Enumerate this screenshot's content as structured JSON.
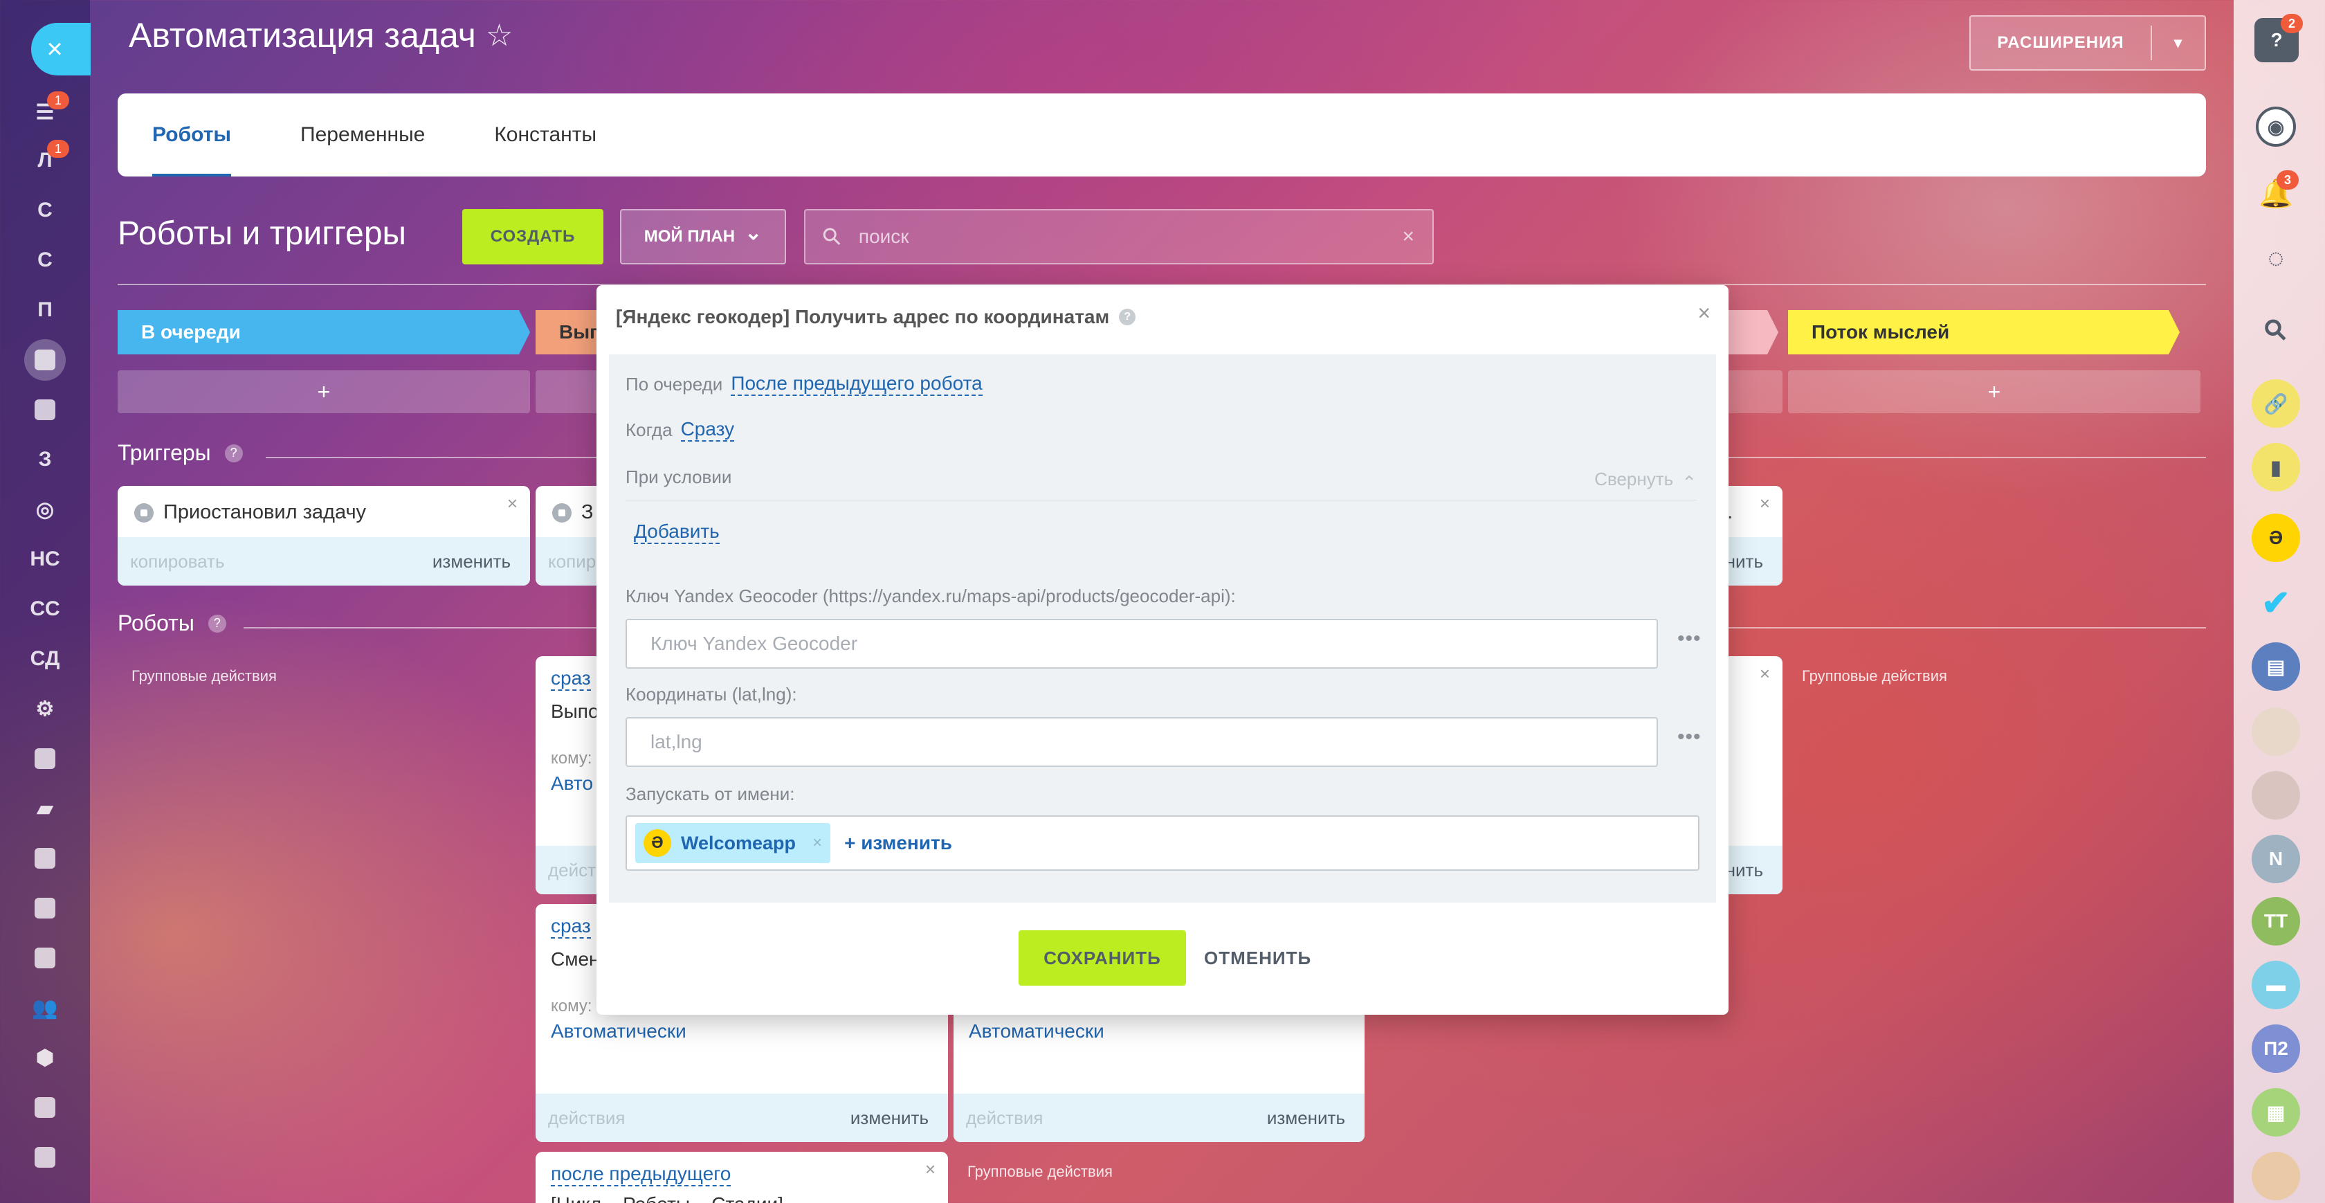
{
  "page": {
    "title": "Автоматизация задач",
    "star": "☆"
  },
  "left_nav": {
    "close": "×",
    "items": [
      {
        "label": "",
        "icon": "filter-icon",
        "badge": "1"
      },
      {
        "label": "Л",
        "badge": "1"
      },
      {
        "label": "С"
      },
      {
        "label": "С"
      },
      {
        "label": "П"
      },
      {
        "label": "",
        "icon": "tasks-icon"
      },
      {
        "label": "",
        "icon": "mail-icon"
      },
      {
        "label": "З"
      },
      {
        "label": "",
        "icon": "target-icon"
      },
      {
        "label": "НС"
      },
      {
        "label": "СС"
      },
      {
        "label": "СД"
      },
      {
        "label": "",
        "icon": "crm-icon"
      },
      {
        "label": "",
        "icon": "sites-icon"
      },
      {
        "label": "",
        "icon": "chat-icon"
      },
      {
        "label": "",
        "icon": "calendar-icon"
      },
      {
        "label": "",
        "icon": "documents-icon"
      },
      {
        "label": "",
        "icon": "store-icon"
      },
      {
        "label": "",
        "icon": "employees-icon"
      },
      {
        "label": "",
        "icon": "shield-icon"
      },
      {
        "label": "",
        "icon": "presentation-icon"
      },
      {
        "label": "",
        "icon": "contact-card-icon"
      }
    ]
  },
  "header": {
    "extensions_label": "РАСШИРЕНИЯ",
    "extensions_arrow": "▾"
  },
  "tabs": [
    {
      "label": "Роботы"
    },
    {
      "label": "Переменные"
    },
    {
      "label": "Константы"
    }
  ],
  "toolbar": {
    "title": "Роботы и триггеры",
    "create_label": "СОЗДАТЬ",
    "plan_label": "МОЙ ПЛАН",
    "plan_arrow": "⌄",
    "search_placeholder": "поиск",
    "search_icon": "⚲",
    "search_clear": "×"
  },
  "stages": [
    {
      "label": "В очереди",
      "color": "#47b6ef"
    },
    {
      "label": "Вып",
      "color": "#f1a07a"
    },
    {
      "label": "",
      "color": "#f6b8c1"
    },
    {
      "label": "Поток мыслей",
      "color": "#fff146"
    }
  ],
  "add_stage_label": "+",
  "triggers": {
    "title": "Триггеры",
    "help": "?",
    "cards": [
      {
        "name": "Приостановил задачу",
        "copy": "копировать",
        "edit": "изменить"
      },
      {
        "name": "З",
        "copy": "копир",
        "edit": ""
      },
      {
        "name": "...",
        "copy": "",
        "edit": "нить"
      }
    ]
  },
  "robots": {
    "title": "Роботы",
    "help": "?",
    "group_actions": [
      "Групповые действия",
      "Групповые действия",
      "Групповые действия"
    ],
    "cards": [
      {
        "when": "сраз",
        "title": "Выпо",
        "whom": "кому:",
        "auto": "Авто",
        "actions": "дейст",
        "edit": ""
      },
      {
        "when": "сраз",
        "title": "Смен",
        "whom": "кому:",
        "auto": "Автоматически",
        "actions": "действия",
        "edit": "изменить"
      },
      {
        "when": "",
        "title": "",
        "whom": "",
        "auto": "Автоматически",
        "actions": "действия",
        "edit": "изменить"
      },
      {
        "when": "после предыдущего",
        "title": "[Цикл... Роботы... Стадии]",
        "whom": "",
        "auto": "",
        "actions": "",
        "edit": ""
      },
      {
        "when": "",
        "title": "",
        "whom": "",
        "auto": "",
        "actions": "",
        "edit": "нить"
      }
    ]
  },
  "modal": {
    "title": "[Яндекс геокодер] Получить адрес по координатам",
    "help": "?",
    "close": "×",
    "queue_label": "По очереди",
    "queue_value": "После предыдущего робота",
    "when_label": "Когда",
    "when_value": "Сразу",
    "condition_label": "При условии",
    "collapse_label": "Свернуть",
    "collapse_icon": "⌃",
    "add_label": "Добавить",
    "key_label": "Ключ Yandex Geocoder (https://yandex.ru/maps-api/products/geocoder-api):",
    "key_placeholder": "Ключ Yandex Geocoder",
    "coords_label": "Координаты (lat,lng):",
    "coords_placeholder": "lat,lng",
    "dots": "•••",
    "run_as_label": "Запускать от имени:",
    "user_name": "Welcomeapp",
    "user_avatar": "Ə",
    "user_remove": "×",
    "change_label": "+ изменить",
    "save_label": "СОХРАНИТЬ",
    "cancel_label": "ОТМЕНИТЬ"
  },
  "right_bar": {
    "help_badge": "2",
    "help_icon": "?",
    "notif_badge": "3",
    "items": [
      {
        "icon": "help-icon",
        "color": "#535c69"
      },
      {
        "icon": "chat-bubble-icon",
        "color": "#535c69"
      },
      {
        "icon": "bell-icon",
        "color": "#535c69"
      },
      {
        "icon": "open-lines-icon",
        "color": "#535c69"
      },
      {
        "icon": "search-icon",
        "color": "#535c69"
      },
      {
        "icon": "link-icon",
        "color": "#f4e36b"
      },
      {
        "icon": "bookmark-icon",
        "color": "#f4e36b"
      },
      {
        "icon": "welcomeapp-icon",
        "color": "#ffd400"
      },
      {
        "icon": "check-icon",
        "color": "#2fc6f6"
      },
      {
        "icon": "document-icon",
        "color": "#5b7fbf"
      },
      {
        "icon": "avatar-1",
        "color": "#e7d8c9"
      },
      {
        "icon": "avatar-2",
        "color": "#d9c4c0"
      },
      {
        "label": "N",
        "color": "#9fb2c2"
      },
      {
        "label": "TT",
        "color": "#8fbc5e"
      },
      {
        "icon": "chat-icon",
        "color": "#7dd0e8"
      },
      {
        "label": "П2",
        "color": "#7f8fd3"
      },
      {
        "icon": "sheet-icon",
        "color": "#a6d47a"
      },
      {
        "icon": "avatar-3",
        "color": "#e9c9a6"
      }
    ]
  }
}
